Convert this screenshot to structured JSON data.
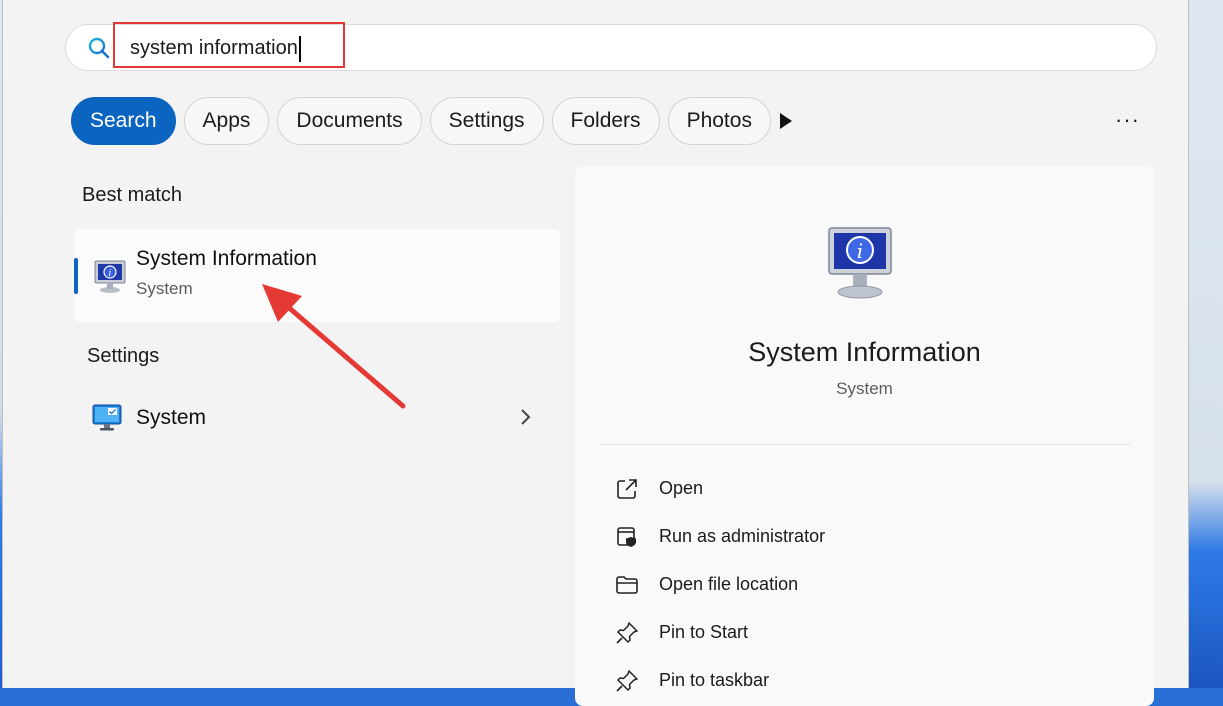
{
  "search": {
    "query": "system information"
  },
  "filters": {
    "tabs": [
      {
        "label": "Search",
        "active": true
      },
      {
        "label": "Apps",
        "active": false
      },
      {
        "label": "Documents",
        "active": false
      },
      {
        "label": "Settings",
        "active": false
      },
      {
        "label": "Folders",
        "active": false
      },
      {
        "label": "Photos",
        "active": false
      }
    ],
    "more_icon": "more-options-icon",
    "play_icon": "play-icon"
  },
  "results": {
    "best_match_title": "Best match",
    "best_match": {
      "title": "System Information",
      "subtitle": "System",
      "icon": "system-information-icon"
    },
    "settings_title": "Settings",
    "settings_item": {
      "label": "System",
      "icon": "monitor-icon"
    }
  },
  "preview": {
    "title": "System Information",
    "subtitle": "System",
    "actions": [
      {
        "label": "Open",
        "icon": "open-external-icon"
      },
      {
        "label": "Run as administrator",
        "icon": "shield-icon"
      },
      {
        "label": "Open file location",
        "icon": "folder-icon"
      },
      {
        "label": "Pin to Start",
        "icon": "pin-icon"
      },
      {
        "label": "Pin to taskbar",
        "icon": "pin-icon"
      }
    ]
  },
  "colors": {
    "accent": "#0a64c0",
    "annotation": "#e53935"
  }
}
